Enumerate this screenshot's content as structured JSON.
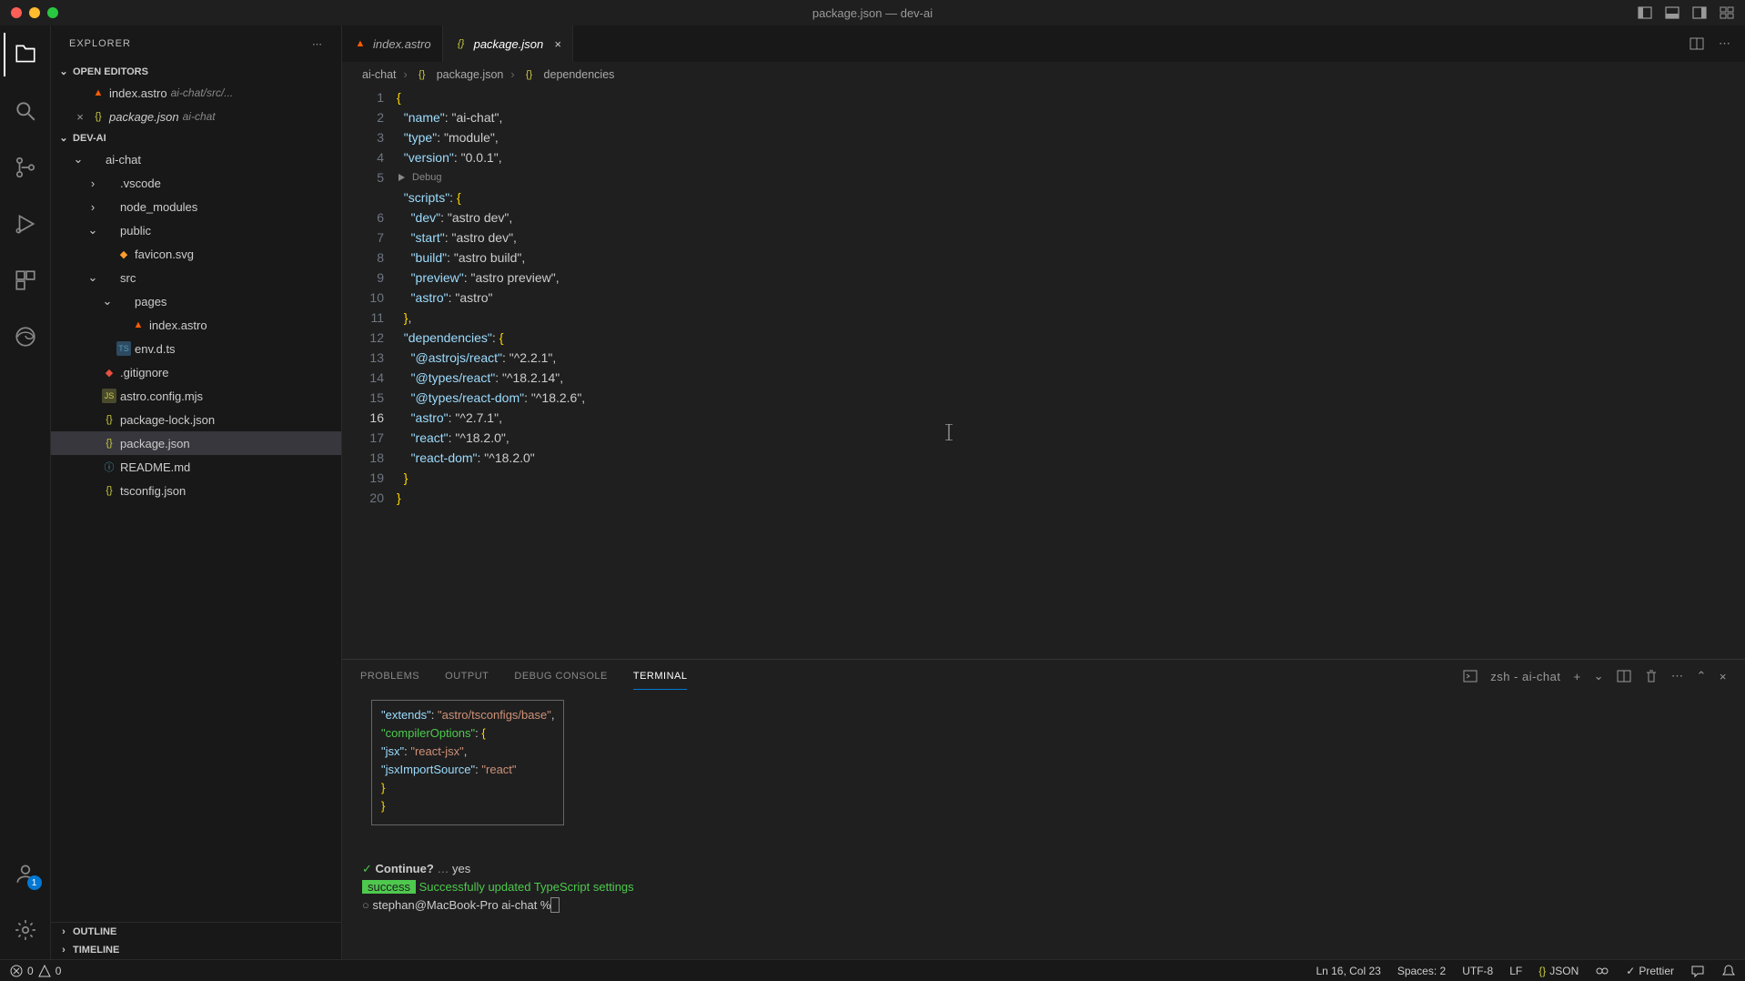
{
  "window": {
    "title": "package.json — dev-ai"
  },
  "sidebar": {
    "title": "EXPLORER",
    "sections": {
      "openEditors": "OPEN EDITORS",
      "project": "DEV-AI",
      "outline": "OUTLINE",
      "timeline": "TIMELINE"
    },
    "openEditors": [
      {
        "name": "index.astro",
        "hint": "ai-chat/src/..."
      },
      {
        "name": "package.json",
        "hint": "ai-chat",
        "closable": true
      }
    ],
    "tree": [
      {
        "name": "ai-chat",
        "type": "folder",
        "depth": 1,
        "open": true
      },
      {
        "name": ".vscode",
        "type": "folder",
        "depth": 2
      },
      {
        "name": "node_modules",
        "type": "folder",
        "depth": 2
      },
      {
        "name": "public",
        "type": "folder",
        "depth": 2,
        "open": true
      },
      {
        "name": "favicon.svg",
        "type": "svg",
        "depth": 3
      },
      {
        "name": "src",
        "type": "folder",
        "depth": 2,
        "open": true
      },
      {
        "name": "pages",
        "type": "folder",
        "depth": 3,
        "open": true
      },
      {
        "name": "index.astro",
        "type": "astro",
        "depth": 4
      },
      {
        "name": "env.d.ts",
        "type": "ts",
        "depth": 3
      },
      {
        "name": ".gitignore",
        "type": "git",
        "depth": 2
      },
      {
        "name": "astro.config.mjs",
        "type": "js",
        "depth": 2
      },
      {
        "name": "package-lock.json",
        "type": "json",
        "depth": 2
      },
      {
        "name": "package.json",
        "type": "json",
        "depth": 2,
        "active": true
      },
      {
        "name": "README.md",
        "type": "md",
        "depth": 2
      },
      {
        "name": "tsconfig.json",
        "type": "json",
        "depth": 2
      }
    ]
  },
  "tabs": [
    {
      "name": "index.astro",
      "icon": "astro"
    },
    {
      "name": "package.json",
      "icon": "json",
      "active": true,
      "closable": true
    }
  ],
  "breadcrumb": [
    "ai-chat",
    "package.json",
    "dependencies"
  ],
  "codelens": "Debug",
  "code": {
    "lines": [
      {
        "n": 1,
        "t": "{",
        "cls": "brace"
      },
      {
        "n": 2,
        "raw": "  \"name\": \"ai-chat\","
      },
      {
        "n": 3,
        "raw": "  \"type\": \"module\","
      },
      {
        "n": 4,
        "raw": "  \"version\": \"0.0.1\","
      },
      {
        "n": 5,
        "raw": "  \"scripts\": {"
      },
      {
        "n": 6,
        "raw": "    \"dev\": \"astro dev\","
      },
      {
        "n": 7,
        "raw": "    \"start\": \"astro dev\","
      },
      {
        "n": 8,
        "raw": "    \"build\": \"astro build\","
      },
      {
        "n": 9,
        "raw": "    \"preview\": \"astro preview\","
      },
      {
        "n": 10,
        "raw": "    \"astro\": \"astro\""
      },
      {
        "n": 11,
        "raw": "  },"
      },
      {
        "n": 12,
        "raw": "  \"dependencies\": {"
      },
      {
        "n": 13,
        "raw": "    \"@astrojs/react\": \"^2.2.1\","
      },
      {
        "n": 14,
        "raw": "    \"@types/react\": \"^18.2.14\","
      },
      {
        "n": 15,
        "raw": "    \"@types/react-dom\": \"^18.2.6\","
      },
      {
        "n": 16,
        "raw": "    \"astro\": \"^2.7.1\",",
        "current": true
      },
      {
        "n": 17,
        "raw": "    \"react\": \"^18.2.0\","
      },
      {
        "n": 18,
        "raw": "    \"react-dom\": \"^18.2.0\""
      },
      {
        "n": 19,
        "raw": "  }"
      },
      {
        "n": 20,
        "raw": "}"
      }
    ]
  },
  "panel": {
    "tabs": [
      "PROBLEMS",
      "OUTPUT",
      "DEBUG CONSOLE",
      "TERMINAL"
    ],
    "activeTab": "TERMINAL",
    "shellLabel": "zsh - ai-chat"
  },
  "terminal": {
    "box": [
      "  \"extends\": \"astro/tsconfigs/base\",",
      "  \"compilerOptions\": {",
      "    \"jsx\": \"react-jsx\",",
      "    \"jsxImportSource\": \"react\"",
      "  }",
      "}"
    ],
    "confirmPrompt": "Continue?",
    "confirmEllipsis": "…",
    "confirmAnswer": "yes",
    "successTag": "success",
    "successMsg": "Successfully updated TypeScript settings",
    "prompt": "stephan@MacBook-Pro ai-chat % "
  },
  "statusbar": {
    "errors": "0",
    "warnings": "0",
    "cursor": "Ln 16, Col 23",
    "spaces": "Spaces: 2",
    "encoding": "UTF-8",
    "eol": "LF",
    "lang": "JSON",
    "formatter": "Prettier"
  },
  "activity": {
    "accountBadge": "1"
  }
}
